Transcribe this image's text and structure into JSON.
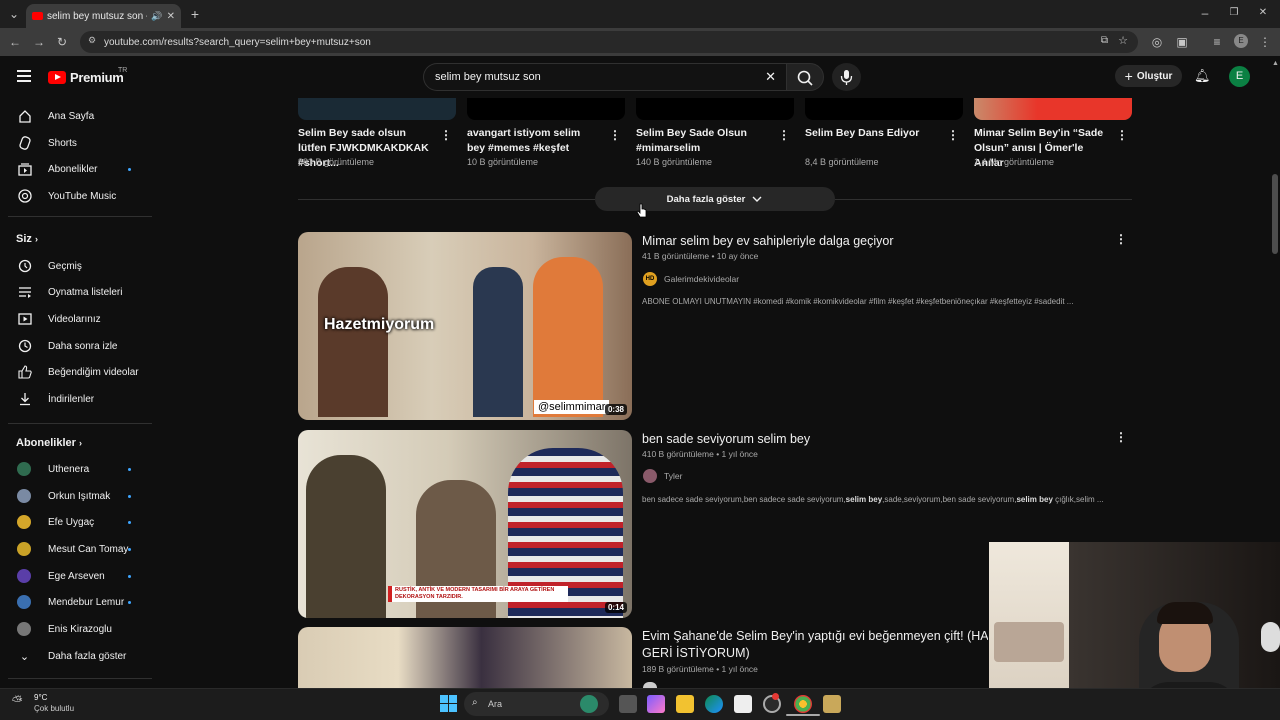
{
  "browser": {
    "tab_title": "selim bey mutsuz son - YouTube",
    "url": "youtube.com/results?search_query=selim+bey+mutsuz+son"
  },
  "header": {
    "logo_text": "Premium",
    "logo_region": "TR",
    "search_value": "selim bey mutsuz son",
    "create_label": "Oluştur",
    "avatar_letter": "E"
  },
  "sidebar": {
    "main": [
      {
        "label": "Ana Sayfa",
        "icon": "home-icon"
      },
      {
        "label": "Shorts",
        "icon": "shorts-icon"
      },
      {
        "label": "Abonelikler",
        "icon": "subscriptions-icon"
      },
      {
        "label": "YouTube Music",
        "icon": "music-icon"
      }
    ],
    "you_label": "Siz",
    "you": [
      {
        "label": "Geçmiş",
        "icon": "history-icon"
      },
      {
        "label": "Oynatma listeleri",
        "icon": "playlist-icon"
      },
      {
        "label": "Videolarınız",
        "icon": "your-videos-icon"
      },
      {
        "label": "Daha sonra izle",
        "icon": "watch-later-icon"
      },
      {
        "label": "Beğendiğim videolar",
        "icon": "like-icon"
      },
      {
        "label": "İndirilenler",
        "icon": "download-icon"
      }
    ],
    "subs_label": "Abonelikler",
    "subs": [
      {
        "label": "Uthenera",
        "color": "#2f6b4f"
      },
      {
        "label": "Orkun Işıtmak",
        "color": "#7a8aa3"
      },
      {
        "label": "Efe Uygaç",
        "color": "#d4a62a"
      },
      {
        "label": "Mesut Can Tomay",
        "color": "#c9a227"
      },
      {
        "label": "Ege Arseven",
        "color": "#5a3ea8"
      },
      {
        "label": "Mendebur Lemur",
        "color": "#3a6fb0"
      },
      {
        "label": "Enis Kirazoglu",
        "color": "#777777"
      }
    ],
    "show_more_label": "Daha fazla göster"
  },
  "shorts": [
    {
      "title": "Selim Bey sade olsun lütfen FJWKDMKAKDKAK #short...",
      "views": "883 B görüntüleme"
    },
    {
      "title": "avangart istiyom selim bey #memes #keşfet",
      "views": "10 B görüntüleme"
    },
    {
      "title": "Selim Bey Sade Olsun #mimarselim",
      "views": "140 B görüntüleme"
    },
    {
      "title": "Selim Bey Dans Ediyor",
      "views": "8,4 B görüntüleme"
    },
    {
      "title": "Mimar Selim Bey'in “Sade Olsun” anısı | Ömer'le Anılar",
      "views": "1,4 Mn görüntüleme"
    }
  ],
  "show_more": "Daha fazla göster",
  "videos": [
    {
      "title": "Mimar selim bey ev sahipleriyle dalga geçiyor",
      "meta": "41 B görüntüleme • 10 ay önce",
      "channel": "Galerimdekivideolar",
      "channel_badge": "HD",
      "description": "ABONE OLMAYI UNUTMAYIN #komedi #komik #komikvideolar #film #keşfet #keşfetbeniöneçıkar #keşfetteyiz #sadedit ...",
      "duration": "0:38",
      "overlay_text": "Hazetmiyorum",
      "watermark": "@selimmimar"
    },
    {
      "title": "ben sade seviyorum selim bey",
      "meta": "410 B görüntüleme • 1 yıl önce",
      "channel": "Tyler",
      "description_pre": "ben sadece sade seviyorum,ben sadece sade seviyorum,",
      "description_bold1": "selim bey",
      "description_mid": ",sade,seviyorum,ben sade seviyorum,",
      "description_bold2": "selim bey",
      "description_post": " çığlık,selim ...",
      "duration": "0:14",
      "banner_text": "RUSTİK, ANTİK VE MODERN TASARIMI BİR ARAYA GETİREN DEKORASYON TARZIDIR."
    },
    {
      "title_line1": "Evim Şahane'de Selim Bey'in yaptığı evi beğenmeyen çift! (HAYIR",
      "title_line2": "GERİ İSTİYORUM)",
      "meta": "189 B görüntüleme • 1 yıl önce"
    }
  ],
  "taskbar": {
    "weather_temp": "9°C",
    "weather_desc": "Çok bulutlu",
    "search_label": "Ara"
  }
}
